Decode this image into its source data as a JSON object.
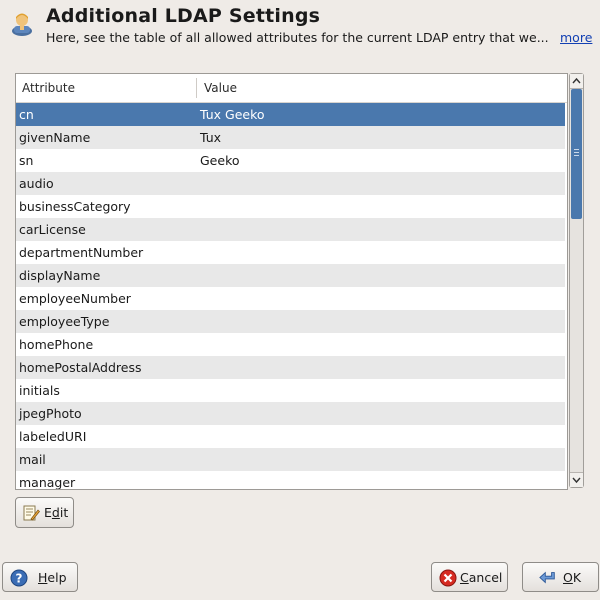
{
  "header": {
    "title": "Additional LDAP Settings",
    "description": "Here, see the table of all allowed attributes for the current LDAP entry that we...",
    "more_link": "more"
  },
  "table": {
    "columns": [
      "Attribute",
      "Value"
    ],
    "selected_index": 0,
    "rows": [
      {
        "attribute": "cn",
        "value": "Tux Geeko"
      },
      {
        "attribute": "givenName",
        "value": "Tux"
      },
      {
        "attribute": "sn",
        "value": "Geeko"
      },
      {
        "attribute": "audio",
        "value": ""
      },
      {
        "attribute": "businessCategory",
        "value": ""
      },
      {
        "attribute": "carLicense",
        "value": ""
      },
      {
        "attribute": "departmentNumber",
        "value": ""
      },
      {
        "attribute": "displayName",
        "value": ""
      },
      {
        "attribute": "employeeNumber",
        "value": ""
      },
      {
        "attribute": "employeeType",
        "value": ""
      },
      {
        "attribute": "homePhone",
        "value": ""
      },
      {
        "attribute": "homePostalAddress",
        "value": ""
      },
      {
        "attribute": "initials",
        "value": ""
      },
      {
        "attribute": "jpegPhoto",
        "value": ""
      },
      {
        "attribute": "labeledURI",
        "value": ""
      },
      {
        "attribute": "mail",
        "value": ""
      },
      {
        "attribute": "manager",
        "value": ""
      }
    ]
  },
  "buttons": {
    "edit": {
      "pre": "E",
      "mnemonic": "d",
      "post": "it"
    },
    "help": {
      "pre": "",
      "mnemonic": "H",
      "post": "elp"
    },
    "cancel": {
      "pre": "",
      "mnemonic": "C",
      "post": "ancel"
    },
    "ok": {
      "pre": "",
      "mnemonic": "O",
      "post": "K"
    }
  },
  "colors": {
    "selection": "#4a78ad",
    "window_bg": "#efebe7",
    "link": "#1340b3"
  },
  "icons": {
    "header": "ldap-user-icon",
    "edit": "edit-pencil-icon",
    "help": "help-icon",
    "cancel": "cancel-icon",
    "ok": "ok-arrow-icon"
  }
}
